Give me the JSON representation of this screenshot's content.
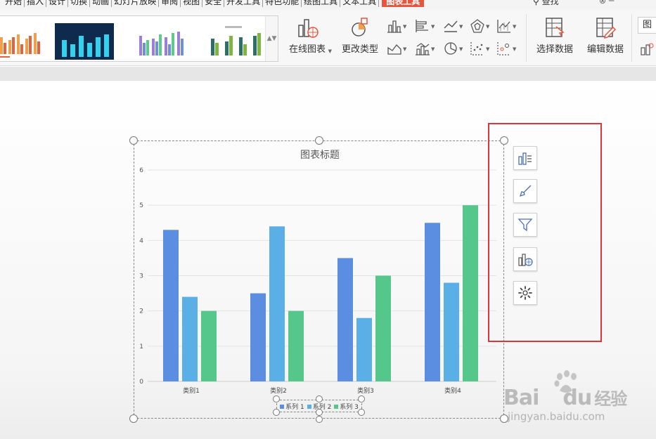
{
  "menubar": {
    "items": [
      "开始",
      "插入",
      "设计",
      "切换",
      "动画",
      "幻灯片放映",
      "审阅",
      "视图",
      "安全",
      "开发工具",
      "特色功能",
      "绘图工具",
      "文本工具"
    ],
    "active": "图表工具",
    "search": "查找",
    "accent_color": "#e8553e"
  },
  "ribbon": {
    "online_chart": "在线图表",
    "change_type": "更改类型",
    "select_data": "选择数据",
    "edit_data": "编辑数据",
    "right_tab": "图"
  },
  "chart": {
    "title": "图表标题",
    "legend": [
      "系列 1",
      "系列 2",
      "系列 3"
    ]
  },
  "chart_data": {
    "type": "bar",
    "title": "图表标题",
    "categories": [
      "类别1",
      "类别2",
      "类别3",
      "类别4"
    ],
    "series": [
      {
        "name": "系列 1",
        "values": [
          4.3,
          2.5,
          3.5,
          4.5
        ],
        "color": "#5b8ee0"
      },
      {
        "name": "系列 2",
        "values": [
          2.4,
          4.4,
          1.8,
          2.8
        ],
        "color": "#5ab0e6"
      },
      {
        "name": "系列 3",
        "values": [
          2,
          2,
          3,
          5
        ],
        "color": "#56c78a"
      }
    ],
    "ylim": [
      0,
      6
    ],
    "yticks": [
      0,
      1,
      2,
      3,
      4,
      5,
      6
    ],
    "grid": true,
    "legend_position": "bottom"
  },
  "side_tools": [
    "chart-elements-icon",
    "chart-style-icon",
    "chart-filter-icon",
    "online-chart-icon",
    "settings-icon"
  ],
  "watermark": {
    "logo": "Bai",
    "logo2": "du",
    "cn": "经验",
    "url": "jingyan.baidu.com"
  }
}
